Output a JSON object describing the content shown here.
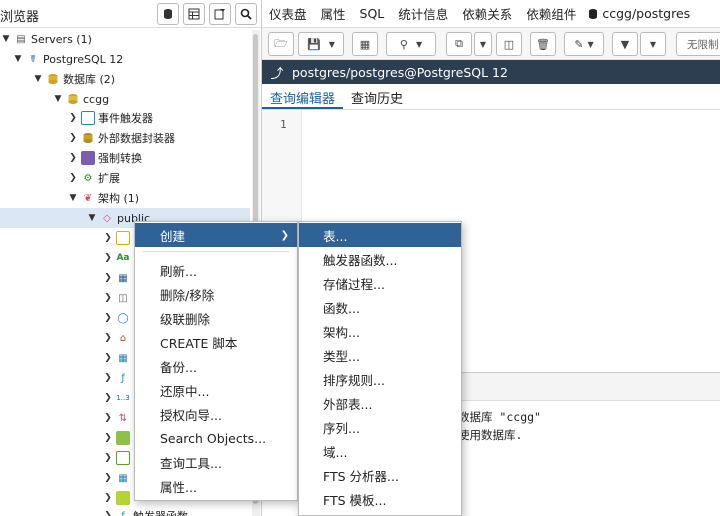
{
  "browser": {
    "title": "浏览器",
    "toolbar_icons": [
      "database-icon",
      "table-icon",
      "filter-icon",
      "search-icon"
    ]
  },
  "tree": [
    {
      "label": "Servers (1)",
      "icon": "servers-icon"
    },
    {
      "label": "PostgreSQL 12",
      "icon": "elephant-icon"
    },
    {
      "label": "数据库 (2)",
      "icon": "databases-icon"
    },
    {
      "label": "ccgg",
      "icon": "database-icon"
    },
    {
      "label": "事件触发器",
      "icon": "event-trigger-icon"
    },
    {
      "label": "外部数据封装器",
      "icon": "fdw-icon"
    },
    {
      "label": "强制转换",
      "icon": "cast-icon"
    },
    {
      "label": "扩展",
      "icon": "extension-icon"
    },
    {
      "label": "架构 (1)",
      "icon": "schemas-icon"
    },
    {
      "label": "public",
      "icon": "schema-icon"
    }
  ],
  "tree_partial": {
    "aa_label": "Aa",
    "seq_label": "1..3",
    "bottom_label": "触发器函数"
  },
  "menubar": [
    "仪表盘",
    "属性",
    "SQL",
    "统计信息",
    "依赖关系",
    "依赖组件",
    "ccgg/postgres"
  ],
  "toolbar": {
    "limit_label": "无限制"
  },
  "connection": {
    "label": "postgres/postgres@PostgreSQL 12"
  },
  "tabs": {
    "query_editor": "查询编辑器",
    "query_history": "查询历史"
  },
  "editor": {
    "line_number": "1"
  },
  "messages": {
    "line1": "数据库 \"ccgg\"",
    "line2": "使用数据库."
  },
  "context_menu": {
    "items": [
      "创建",
      "刷新...",
      "删除/移除",
      "级联删除",
      "CREATE 脚本",
      "备份...",
      "还原中...",
      "授权向导...",
      "Search Objects...",
      "查询工具...",
      "属性..."
    ]
  },
  "create_submenu": {
    "items": [
      "表...",
      "触发器函数...",
      "存储过程...",
      "函数...",
      "架构...",
      "类型...",
      "排序规则...",
      "外部表...",
      "序列...",
      "域...",
      "FTS 分析器...",
      "FTS 模板..."
    ]
  },
  "colors": {
    "highlight": "#2f6397",
    "conn_bar": "#2d3e50",
    "tab_active": "#1a5f9e"
  }
}
